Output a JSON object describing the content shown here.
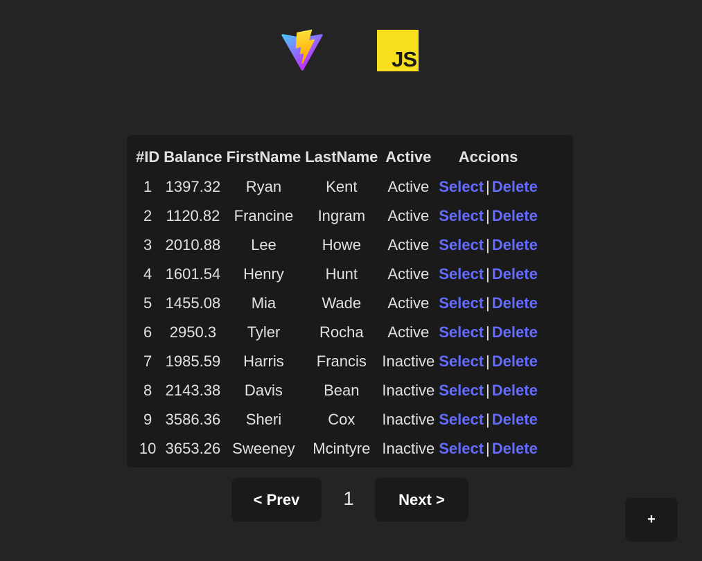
{
  "logos": {
    "vite": "vite-logo",
    "js_text": "JS"
  },
  "table": {
    "headers": [
      "#ID",
      "Balance",
      "FirstName",
      "LastName",
      "Active",
      "Accions"
    ],
    "rows": [
      {
        "id": "1",
        "balance": "1397.32",
        "first": "Ryan",
        "last": "Kent",
        "active": "Active"
      },
      {
        "id": "2",
        "balance": "1120.82",
        "first": "Francine",
        "last": "Ingram",
        "active": "Active"
      },
      {
        "id": "3",
        "balance": "2010.88",
        "first": "Lee",
        "last": "Howe",
        "active": "Active"
      },
      {
        "id": "4",
        "balance": "1601.54",
        "first": "Henry",
        "last": "Hunt",
        "active": "Active"
      },
      {
        "id": "5",
        "balance": "1455.08",
        "first": "Mia",
        "last": "Wade",
        "active": "Active"
      },
      {
        "id": "6",
        "balance": "2950.3",
        "first": "Tyler",
        "last": "Rocha",
        "active": "Active"
      },
      {
        "id": "7",
        "balance": "1985.59",
        "first": "Harris",
        "last": "Francis",
        "active": "Inactive"
      },
      {
        "id": "8",
        "balance": "2143.38",
        "first": "Davis",
        "last": "Bean",
        "active": "Inactive"
      },
      {
        "id": "9",
        "balance": "3586.36",
        "first": "Sheri",
        "last": "Cox",
        "active": "Inactive"
      },
      {
        "id": "10",
        "balance": "3653.26",
        "first": "Sweeney",
        "last": "Mcintyre",
        "active": "Inactive"
      }
    ],
    "select_label": "Select",
    "separator": "|",
    "delete_label": "Delete"
  },
  "pager": {
    "prev_label": "< Prev",
    "page": "1",
    "next_label": "Next >"
  },
  "add_label": "+",
  "colors": {
    "background": "#242424",
    "panel": "#1a1a1a",
    "link": "#646cff",
    "js_yellow": "#f7df1e"
  }
}
